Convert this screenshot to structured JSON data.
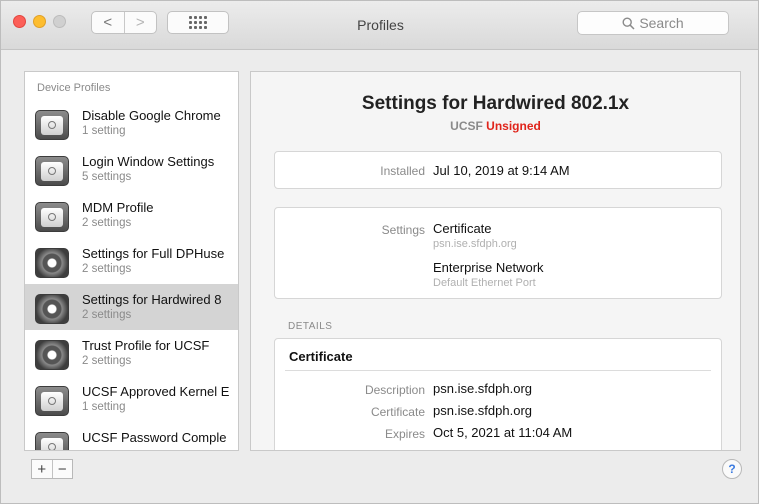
{
  "window": {
    "title": "Profiles"
  },
  "toolbar": {
    "back_glyph": "<",
    "forward_glyph": ">",
    "search_placeholder": "Search"
  },
  "sidebar": {
    "header": "Device Profiles",
    "items": [
      {
        "name": "Disable Google Chrome",
        "sub": "1 setting",
        "icon": "profile-icon",
        "selected": false
      },
      {
        "name": "Login Window Settings",
        "sub": "5 settings",
        "icon": "profile-icon",
        "selected": false
      },
      {
        "name": "MDM Profile",
        "sub": "2 settings",
        "icon": "profile-icon",
        "selected": false
      },
      {
        "name": "Settings for Full DPHuse",
        "sub": "2 settings",
        "icon": "gear-icon",
        "selected": false
      },
      {
        "name": "Settings for Hardwired 8",
        "sub": "2 settings",
        "icon": "gear-icon",
        "selected": true
      },
      {
        "name": "Trust Profile for UCSF",
        "sub": "2 settings",
        "icon": "gear-icon",
        "selected": false
      },
      {
        "name": "UCSF Approved Kernel E",
        "sub": "1 setting",
        "icon": "profile-icon",
        "selected": false
      },
      {
        "name": "UCSF Password Comple",
        "sub": "",
        "icon": "profile-icon",
        "selected": false
      }
    ],
    "add_label": "+",
    "remove_label": "−"
  },
  "detail": {
    "title": "Settings for Hardwired 802.1x",
    "org": "UCSF",
    "signature_status": "Unsigned",
    "installed_label": "Installed",
    "installed_value": "Jul 10, 2019 at 9:14 AM",
    "settings_label": "Settings",
    "settings": [
      {
        "name": "Certificate",
        "detail": "psn.ise.sfdph.org"
      },
      {
        "name": "Enterprise Network",
        "detail": "Default Ethernet Port"
      }
    ],
    "details_header": "DETAILS",
    "certificate": {
      "title": "Certificate",
      "rows": [
        {
          "label": "Description",
          "value": "psn.ise.sfdph.org"
        },
        {
          "label": "Certificate",
          "value": "psn.ise.sfdph.org"
        },
        {
          "label": "Expires",
          "value": "Oct 5, 2021 at 11:04 AM"
        }
      ]
    }
  },
  "help": {
    "label": "?"
  },
  "colors": {
    "unsigned": "#e0241b",
    "selection": "#d4d4d4",
    "help_accent": "#3c7be0"
  }
}
